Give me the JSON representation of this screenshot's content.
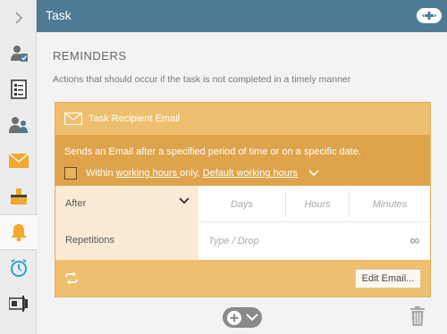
{
  "header": {
    "title": "Task"
  },
  "rail": {
    "icons": [
      "chevron-right-icon",
      "user-check-icon",
      "form-icon",
      "users-icon",
      "envelope-icon",
      "ballot-box-icon",
      "bell-icon",
      "stopwatch-icon",
      "sign-icon"
    ]
  },
  "reminders": {
    "title": "REMINDERS",
    "description": "Actions that should occur if the task is not completed in a timely manner"
  },
  "card": {
    "title": "Task Recipient Email",
    "body_text": "Sends an Email after a specified period of time or on a specific date.",
    "within_prefix": "Within ",
    "working_hours_link": "working hours ",
    "only_text": "only, ",
    "default_hours_link": "Default working hours",
    "after_label": "After",
    "days_placeholder": "Days",
    "hours_placeholder": "Hours",
    "minutes_placeholder": "Minutes",
    "repetitions_label": "Repetitions",
    "repetitions_placeholder": "Type / Drop",
    "infinity_symbol": "∞",
    "edit_button": "Edit Email..."
  },
  "colors": {
    "header": "#4d7b95",
    "card": "#eebf6e",
    "card_body": "#dfa44b",
    "active_icon": "#f0a830"
  }
}
